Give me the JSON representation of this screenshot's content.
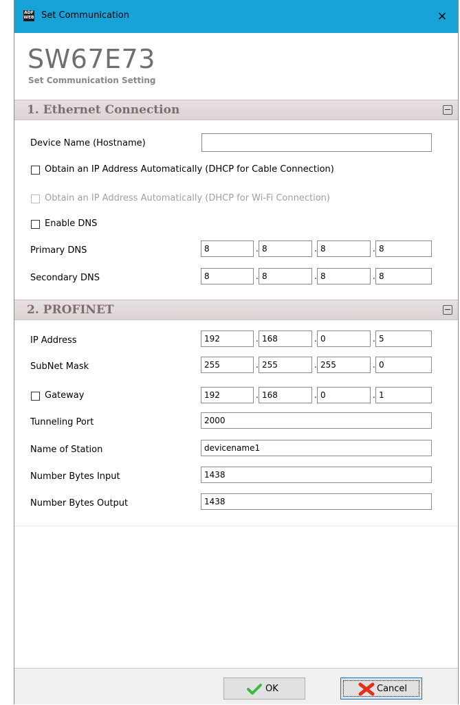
{
  "window": {
    "title": "Set Communication",
    "icon_text": "ADF WEB",
    "close_label": "×"
  },
  "header": {
    "product_code": "SW67E73",
    "subtitle": "Set Communication Setting"
  },
  "ethernet": {
    "title": "1. Ethernet Connection",
    "device_name_label": "Device Name (Hostname)",
    "device_name_value": "",
    "dhcp_cable_label": "Obtain an IP Address Automatically (DHCP for Cable Connection)",
    "dhcp_wifi_label": "Obtain an IP Address Automatically (DHCP for Wi-Fi Connection)",
    "enable_dns_label": "Enable DNS",
    "primary_dns_label": "Primary DNS",
    "primary_dns": [
      "8",
      "8",
      "8",
      "8"
    ],
    "secondary_dns_label": "Secondary DNS",
    "secondary_dns": [
      "8",
      "8",
      "8",
      "8"
    ]
  },
  "profinet": {
    "title": "2. PROFINET",
    "ip_label": "IP Address",
    "ip": [
      "192",
      "168",
      "0",
      "5"
    ],
    "subnet_label": "SubNet Mask",
    "subnet": [
      "255",
      "255",
      "255",
      "0"
    ],
    "gateway_label": "Gateway",
    "gateway": [
      "192",
      "168",
      "0",
      "1"
    ],
    "tunneling_port_label": "Tunneling Port",
    "tunneling_port": "2000",
    "station_name_label": "Name of Station",
    "station_name": "devicename1",
    "bytes_input_label": "Number Bytes Input",
    "bytes_input": "1438",
    "bytes_output_label": "Number Bytes Output",
    "bytes_output": "1438"
  },
  "footer": {
    "ok_label": "OK",
    "cancel_label": "Cancel"
  },
  "colors": {
    "titlebar": "#17a2d8",
    "section_header": "#dcd3d3",
    "ok_check": "#3cb83c",
    "cancel_x": "#e0301e"
  },
  "icons": [
    "app-icon",
    "close-icon",
    "collapse-icon",
    "check-icon",
    "cross-icon"
  ]
}
